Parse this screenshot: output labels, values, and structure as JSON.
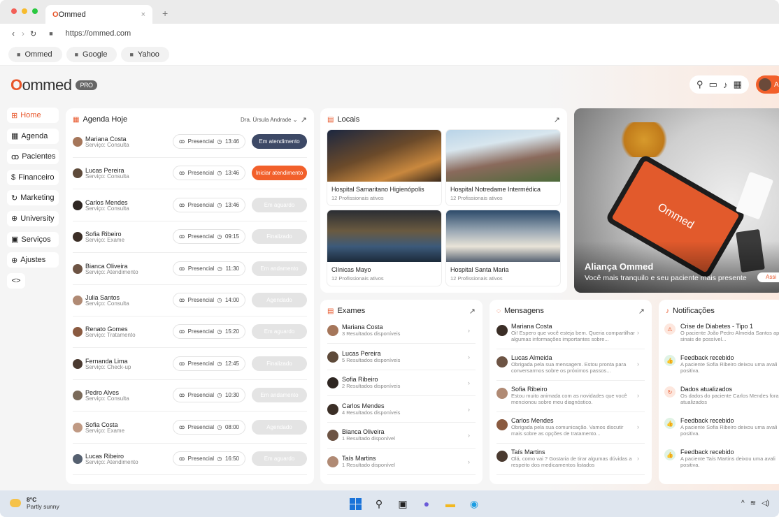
{
  "browser": {
    "tab_title": "Ommed",
    "tab_close": "×",
    "new_tab": "+",
    "url": "https://ommed.com",
    "bookmarks": [
      {
        "label": "Ommed"
      },
      {
        "label": "Google"
      },
      {
        "label": "Yahoo"
      }
    ]
  },
  "header": {
    "logo_text": "ommed",
    "logo_prefix": "O",
    "pro_badge": "PRO",
    "user_initial": "A"
  },
  "sidebar": {
    "items": [
      {
        "label": "Home",
        "icon": "grid-icon",
        "glyph": "⊞"
      },
      {
        "label": "Agenda",
        "icon": "calendar-icon",
        "glyph": "▦"
      },
      {
        "label": "Pacientes",
        "icon": "users-icon",
        "glyph": "ꝏ"
      },
      {
        "label": "Financeiro",
        "icon": "dollar-icon",
        "glyph": "$"
      },
      {
        "label": "Marketing",
        "icon": "refresh-icon",
        "glyph": "↻"
      },
      {
        "label": "University",
        "icon": "globe-icon",
        "glyph": "⊕"
      },
      {
        "label": "Serviços",
        "icon": "briefcase-icon",
        "glyph": "▣"
      },
      {
        "label": "Ajustes",
        "icon": "settings-icon",
        "glyph": "⊕"
      }
    ],
    "collapse_glyph": "<>"
  },
  "agenda": {
    "title": "Agenda Hoje",
    "doctor": "Dra. Úrsula Andrade",
    "rows": [
      {
        "name": "Mariana Costa",
        "service": "Serviço: Consulta",
        "type": "Presencial",
        "time": "13:46",
        "status": "Em atendimento",
        "status_color": "#3d4966"
      },
      {
        "name": "Lucas Pereira",
        "service": "Serviço: Consulta",
        "type": "Presencial",
        "time": "13:46",
        "status": "Iniciar atendimento",
        "status_color": "#f2602b"
      },
      {
        "name": "Carlos Mendes",
        "service": "Serviço: Consulta",
        "type": "Presencial",
        "time": "13:46",
        "status": "Em aguardo",
        "status_color": "#e4e4e4"
      },
      {
        "name": "Sofia Ribeiro",
        "service": "Serviço: Exame",
        "type": "Presencial",
        "time": "09:15",
        "status": "Finalizado",
        "status_color": "#e4e4e4"
      },
      {
        "name": "Bianca Oliveira",
        "service": "Serviço: Atendimento",
        "type": "Presencial",
        "time": "11:30",
        "status": "Em andamento",
        "status_color": "#e4e4e4"
      },
      {
        "name": "Julia Santos",
        "service": "Serviço: Consulta",
        "type": "Presencial",
        "time": "14:00",
        "status": "Agendado",
        "status_color": "#e4e4e4"
      },
      {
        "name": "Renato Gomes",
        "service": "Serviço: Tratamento",
        "type": "Presencial",
        "time": "15:20",
        "status": "Em aguardo",
        "status_color": "#e4e4e4"
      },
      {
        "name": "Fernanda Lima",
        "service": "Serviço: Check-up",
        "type": "Presencial",
        "time": "12:45",
        "status": "Finalizado",
        "status_color": "#e4e4e4"
      },
      {
        "name": "Pedro Alves",
        "service": "Serviço: Consulta",
        "type": "Presencial",
        "time": "10:30",
        "status": "Em andamento",
        "status_color": "#e4e4e4"
      },
      {
        "name": "Sofia Costa",
        "service": "Serviço: Exame",
        "type": "Presencial",
        "time": "08:00",
        "status": "Agendado",
        "status_color": "#e4e4e4"
      },
      {
        "name": "Lucas Ribeiro",
        "service": "Serviço: Atendimento",
        "type": "Presencial",
        "time": "16:50",
        "status": "Em aguardo",
        "status_color": "#e4e4e4"
      }
    ]
  },
  "locais": {
    "title": "Locais",
    "items": [
      {
        "name": "Hospital Samaritano Higienópolis",
        "sub": "12 Profissionais ativos"
      },
      {
        "name": "Hospital Notredame Intermédica",
        "sub": "12 Profissionais ativos"
      },
      {
        "name": "Clínicas Mayo",
        "sub": "12 Profissionais ativos"
      },
      {
        "name": "Hospital Santa Maria",
        "sub": "12 Profissionais ativos"
      }
    ]
  },
  "hero": {
    "title": "Aliança Ommed",
    "subtitle": "Você mais tranquilo e seu paciente mais presente",
    "button": "Assi",
    "device_text": "Ommed"
  },
  "exames": {
    "title": "Exames",
    "items": [
      {
        "name": "Mariana Costa",
        "sub": "3 Resultados disponíveis"
      },
      {
        "name": "Lucas Pereira",
        "sub": "5 Resultados disponíveis"
      },
      {
        "name": "Sofia Ribeiro",
        "sub": "2 Resultados disponíveis"
      },
      {
        "name": "Carlos Mendes",
        "sub": "4 Resultados disponíveis"
      },
      {
        "name": "Bianca Oliveira",
        "sub": "1 Resultado disponível"
      },
      {
        "name": "Taís Martins",
        "sub": "1 Resultado disponível"
      }
    ]
  },
  "mensagens": {
    "title": "Mensagens",
    "items": [
      {
        "name": "Mariana Costa",
        "line1": "Oi! Espero que você esteja bem. Queria compartilhar",
        "line2": "algumas informações importantes sobre..."
      },
      {
        "name": "Lucas Almeida",
        "line1": "Obrigada pela sua mensagem. Estou pronta para",
        "line2": "conversarmos sobre os próximos passos..."
      },
      {
        "name": "Sofia Ribeiro",
        "line1": "Estou muito animada com as novidades que você",
        "line2": "mencionou sobre meu diagnóstico."
      },
      {
        "name": "Carlos Mendes",
        "line1": "Obrigada pela sua comunicação. Vamos discutir",
        "line2": "mais sobre as opções de tratamento..."
      },
      {
        "name": "Taís Martins",
        "line1": "Olá, como vai ? Gostaria de tirar algumas dúvidas a",
        "line2": "respeito dos medicamentos listados"
      }
    ]
  },
  "notificacoes": {
    "title": "Notificações",
    "items": [
      {
        "title": "Crise de Diabetes - Tipo 1",
        "line1": "O paciente João Pedro Almeida Santos ap",
        "line2": "sinais de possível...",
        "icon": "alert-icon",
        "glyph": "⚠",
        "color": "#e8562a",
        "bg": "#fde7de"
      },
      {
        "title": "Feedback recebido",
        "line1": "A paciente Sofia Ribeiro deixou uma avali",
        "line2": "positiva.",
        "icon": "thumbs-up-icon",
        "glyph": "👍",
        "color": "#2e9a4a",
        "bg": "#e0f3e5"
      },
      {
        "title": "Dados atualizados",
        "line1": "Os dados do paciente Carlos Mendes foran",
        "line2": "atualizados",
        "icon": "sync-icon",
        "glyph": "↻",
        "color": "#e8562a",
        "bg": "#fde7de"
      },
      {
        "title": "Feedback recebido",
        "line1": "A paciente Sofia Ribeiro deixou uma avali",
        "line2": "positiva.",
        "icon": "thumbs-up-icon",
        "glyph": "👍",
        "color": "#2e9a4a",
        "bg": "#e0f3e5"
      },
      {
        "title": "Feedback recebido",
        "line1": "A paciente Taís Martins deixou uma avali",
        "line2": "positiva.",
        "icon": "thumbs-up-icon",
        "glyph": "👍",
        "color": "#2e9a4a",
        "bg": "#e0f3e5"
      }
    ]
  },
  "taskbar": {
    "temp": "8°C",
    "condition": "Partly sunny"
  },
  "colors": {
    "accent": "#e8562a",
    "dark_status": "#3d4966"
  }
}
